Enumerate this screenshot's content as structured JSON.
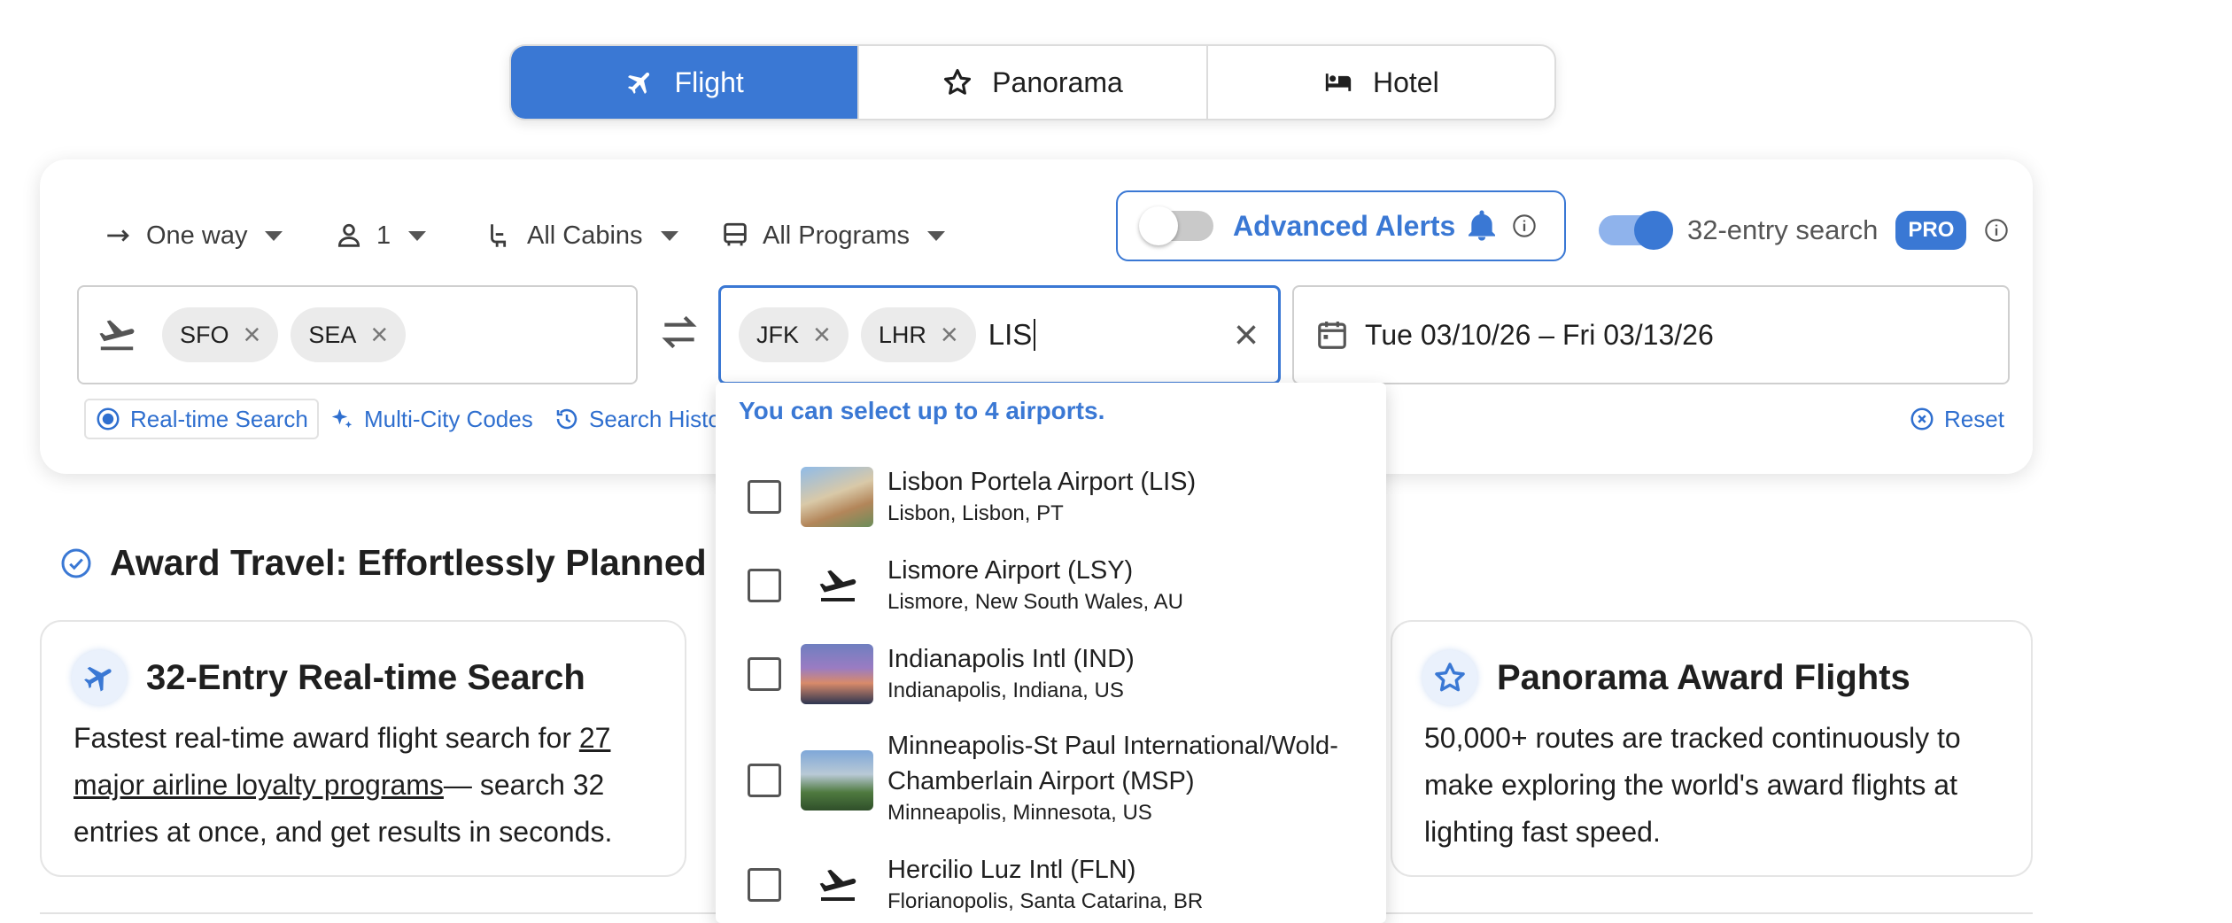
{
  "tabs": [
    {
      "label": "Flight",
      "icon": "plane-icon",
      "active": true
    },
    {
      "label": "Panorama",
      "icon": "star-icon",
      "active": false
    },
    {
      "label": "Hotel",
      "icon": "bed-icon",
      "active": false
    }
  ],
  "options": {
    "trip_type": "One way",
    "passengers": "1",
    "cabins": "All Cabins",
    "programs": "All Programs"
  },
  "alerts": {
    "label": "Advanced Alerts",
    "enabled": false
  },
  "entry_search": {
    "label": "32-entry search",
    "badge": "PRO",
    "enabled": true
  },
  "origin": {
    "chips": [
      "SFO",
      "SEA"
    ]
  },
  "destination": {
    "chips": [
      "JFK",
      "LHR"
    ],
    "typed": "LIS"
  },
  "dates": {
    "value": "Tue 03/10/26 – Fri 03/13/26"
  },
  "sub_links": {
    "realtime": "Real-time Search",
    "multicity": "Multi-City Codes",
    "history": "Search Histo",
    "reset": "Reset"
  },
  "section": {
    "title": "Award Travel: Effortlessly Planned"
  },
  "features": [
    {
      "title": "32-Entry Real-time Search",
      "body_pre": "Fastest real-time award flight search for ",
      "body_link": "27 major airline loyalty programs",
      "body_post": "— search 32 entries at once, and get results in seconds."
    },
    {
      "title": "Panorama Award Flights",
      "body": "50,000+ routes are tracked continuously to make exploring the world's award flights at lighting fast speed."
    }
  ],
  "dropdown": {
    "hint": "You can select up to 4 airports.",
    "items": [
      {
        "name": "Lisbon Portela Airport (LIS)",
        "sub": "Lisbon, Lisbon, PT",
        "thumb": "city-photo"
      },
      {
        "name": "Lismore Airport (LSY)",
        "sub": "Lismore, New South Wales, AU",
        "thumb": "plane-icon"
      },
      {
        "name": "Indianapolis Intl (IND)",
        "sub": "Indianapolis, Indiana, US",
        "thumb": "city-photo"
      },
      {
        "name": "Minneapolis-St Paul International/Wold-Chamberlain Airport (MSP)",
        "sub": "Minneapolis, Minnesota, US",
        "thumb": "city-photo"
      },
      {
        "name": "Hercilio Luz Intl (FLN)",
        "sub": "Florianopolis, Santa Catarina, BR",
        "thumb": "plane-icon"
      }
    ]
  },
  "colors": {
    "accent": "#3a78d4",
    "text": "#1f1f1f",
    "border": "#dcdcdc"
  }
}
